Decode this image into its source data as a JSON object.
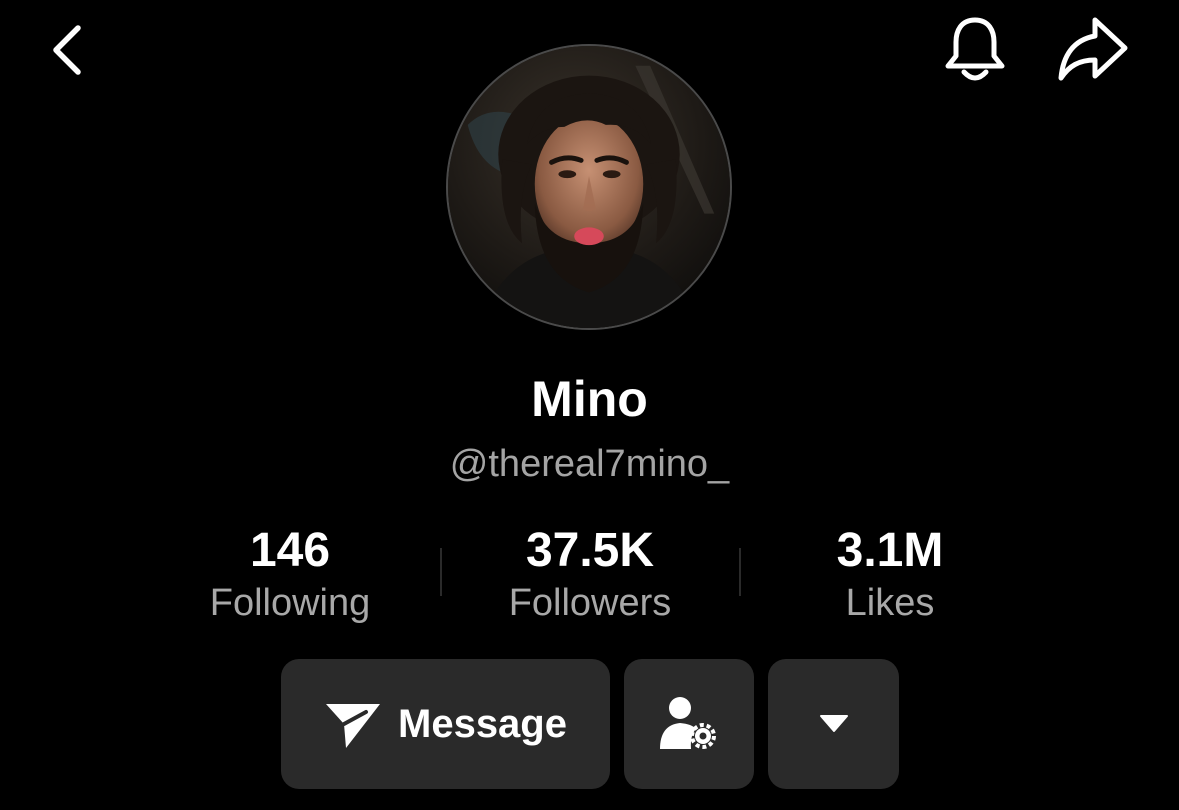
{
  "header": {
    "back_icon": "chevron-left-icon",
    "notification_icon": "bell-icon",
    "share_icon": "share-arrow-icon"
  },
  "profile": {
    "display_name": "Mino",
    "handle": "@thereal7mino_",
    "avatar": "profile-photo"
  },
  "stats": [
    {
      "value": "146",
      "label": "Following"
    },
    {
      "value": "37.5K",
      "label": "Followers"
    },
    {
      "value": "3.1M",
      "label": "Likes"
    }
  ],
  "actions": {
    "message_label": "Message",
    "message_icon": "paper-plane-icon",
    "profile_settings_icon": "user-gear-icon",
    "more_icon": "caret-down-icon"
  },
  "colors": {
    "background": "#000000",
    "text_primary": "#ffffff",
    "text_secondary": "#a4a4a4",
    "button_background": "#2a2a2a"
  }
}
